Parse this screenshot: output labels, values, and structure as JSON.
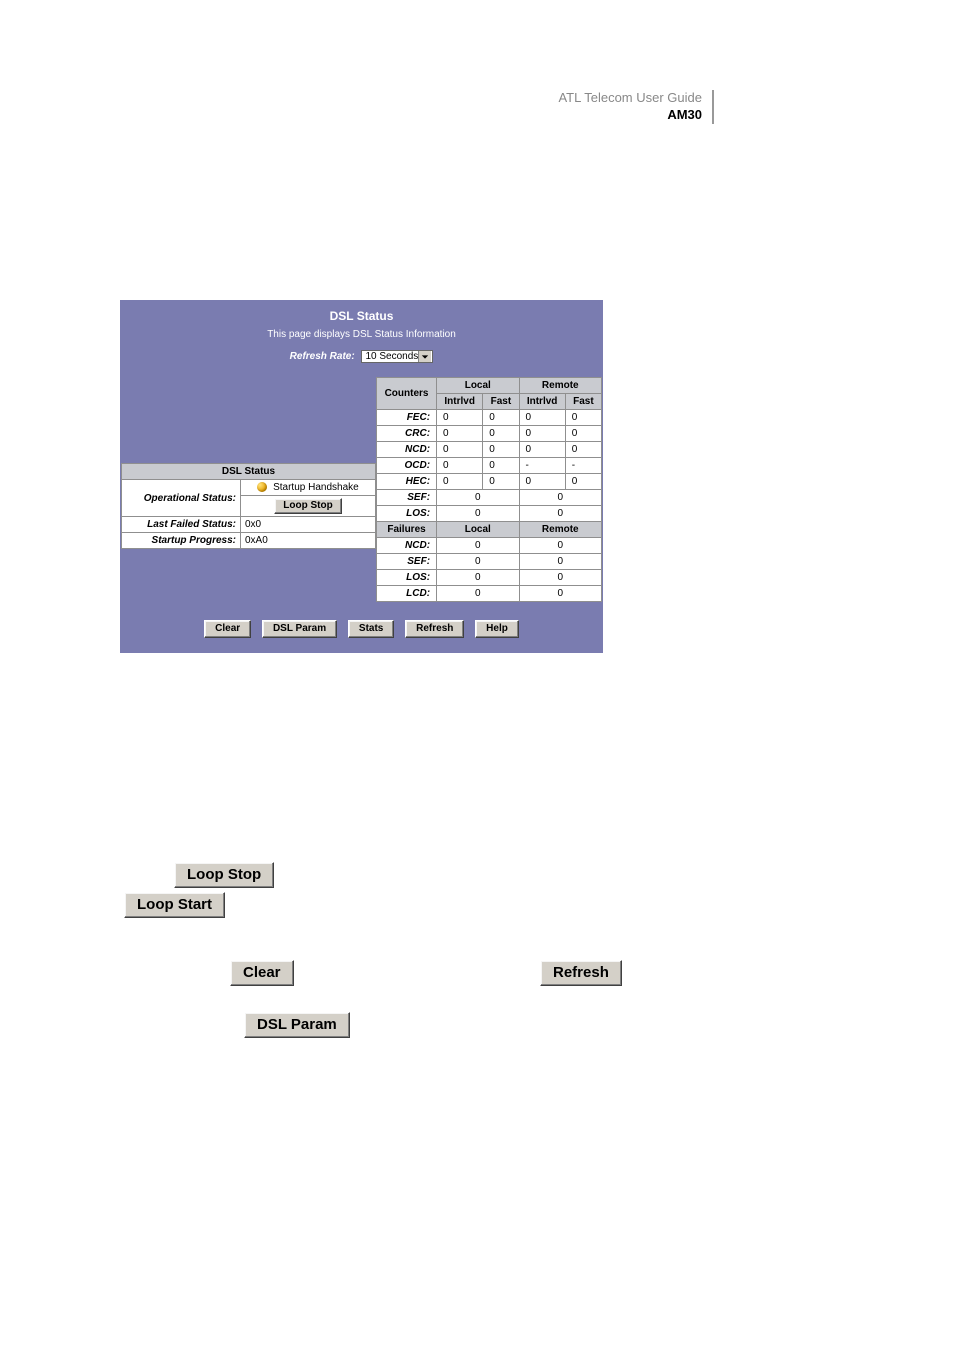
{
  "header": {
    "line1": "ATL Telecom User Guide",
    "line2": "AM30"
  },
  "panel": {
    "title": "DSL Status",
    "desc": "This page displays DSL Status Information",
    "refresh_label": "Refresh Rate:",
    "refresh_value": "10 Seconds"
  },
  "status": {
    "header": "DSL Status",
    "operational_label": "Operational Status:",
    "operational_value": "Startup Handshake",
    "loop_btn": "Loop Stop",
    "last_failed_label": "Last Failed Status:",
    "last_failed_value": "0x0",
    "startup_label": "Startup Progress:",
    "startup_value": "0xA0"
  },
  "counters": {
    "header": "Counters",
    "local": "Local",
    "remote": "Remote",
    "intrlvd": "Intrlvd",
    "fast": "Fast",
    "rows": [
      {
        "name": "FEC:",
        "li": "0",
        "lf": "0",
        "ri": "0",
        "rf": "0"
      },
      {
        "name": "CRC:",
        "li": "0",
        "lf": "0",
        "ri": "0",
        "rf": "0"
      },
      {
        "name": "NCD:",
        "li": "0",
        "lf": "0",
        "ri": "0",
        "rf": "0"
      },
      {
        "name": "OCD:",
        "li": "0",
        "lf": "0",
        "ri": "-",
        "rf": "-"
      },
      {
        "name": "HEC:",
        "li": "0",
        "lf": "0",
        "ri": "0",
        "rf": "0"
      }
    ],
    "pair_rows": [
      {
        "name": "SEF:",
        "local": "0",
        "remote": "0"
      },
      {
        "name": "LOS:",
        "local": "0",
        "remote": "0"
      }
    ]
  },
  "failures": {
    "header": "Failures",
    "local": "Local",
    "remote": "Remote",
    "rows": [
      {
        "name": "NCD:",
        "local": "0",
        "remote": "0"
      },
      {
        "name": "SEF:",
        "local": "0",
        "remote": "0"
      },
      {
        "name": "LOS:",
        "local": "0",
        "remote": "0"
      },
      {
        "name": "LCD:",
        "local": "0",
        "remote": "0"
      }
    ]
  },
  "buttons": {
    "clear": "Clear",
    "dslparam": "DSL Param",
    "stats": "Stats",
    "refresh": "Refresh",
    "help": "Help"
  },
  "big_buttons": {
    "loop_stop": "Loop Stop",
    "loop_start": "Loop Start",
    "clear": "Clear",
    "refresh": "Refresh",
    "dslparam": "DSL Param"
  }
}
